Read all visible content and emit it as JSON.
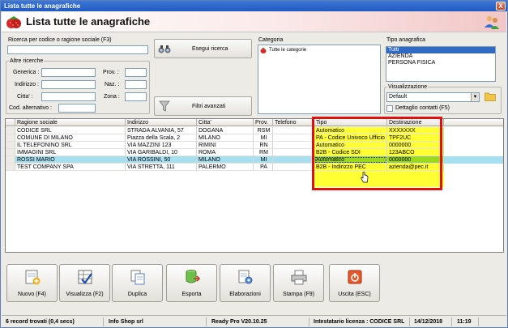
{
  "window": {
    "title": "Lista tutte le anagrafiche",
    "close_label": "X"
  },
  "header": {
    "title": "Lista tutte le anagrafiche"
  },
  "search": {
    "main_label": "Ricerca per codice o ragione sociale (F3)",
    "main_value": "",
    "execute_label": "Esegui ricerca",
    "other_label": "Altre ricerche",
    "fields": {
      "generica": "Generica :",
      "indirizzo": "Indirizzo :",
      "citta": "Citta' :",
      "cod_alt": "Cod. alternativo :",
      "prov": "Prov. :",
      "naz": "Naz. :",
      "zona": "Zona :"
    },
    "advanced_label": "Filtri avanzati"
  },
  "category": {
    "label": "Categoria",
    "item": "Tutte le categorie"
  },
  "tipo_anagrafica": {
    "label": "Tipo anagrafica",
    "items": [
      "Tutti",
      "AZIENDA",
      "PERSONA FISICA"
    ]
  },
  "visualizzazione": {
    "label": "Visualizzazione",
    "value": "Default",
    "checkbox_label": "Dettaglio contatti (F5)"
  },
  "grid": {
    "headers": [
      "Ragione sociale",
      "Indirizzo",
      "Citta'",
      "Prov.",
      "Telefono",
      "Tipo",
      "Destinazione"
    ],
    "rows": [
      [
        "CODICE SRL",
        "STRADA ALVANIA, 57",
        "DOGANA",
        "RSM",
        "",
        "Automatico",
        "XXXXXXX"
      ],
      [
        "COMUNE DI MILANO",
        "Piazza della Scala, 2",
        "MILANO",
        "MI",
        "",
        "PA - Codice Univoco Ufficio CUU",
        "TPF2UC"
      ],
      [
        "IL TELEFONINO SRL",
        "VIA MAZZINI 123",
        "RIMINI",
        "RN",
        "",
        "Automatico",
        "0000000"
      ],
      [
        "IMMAGINI SRL",
        "VIA GARIBALDI, 10",
        "ROMA",
        "RM",
        "",
        "B2B - Codice SDI",
        "123ABCO"
      ],
      [
        "ROSSI MARIO",
        "VIA ROSSINI, 50",
        "MILANO",
        "MI",
        "",
        "Automatico",
        "0000000"
      ],
      [
        "TEST COMPANY SPA",
        "VIA STRETTA, 111",
        "PALERMO",
        "PA",
        "",
        "B2B - Indirizzo PEC",
        "azienda@pec.it"
      ]
    ]
  },
  "toolbar": {
    "nuovo": "Nuovo (F4)",
    "visualizza": "Visualizza (F2)",
    "duplica": "Duplica",
    "esporta": "Esporta",
    "elaborazioni": "Elaborazioni",
    "stampa": "Stampa (F9)",
    "uscita": "Uscita (ESC)"
  },
  "status": {
    "records": "6 record trovati (0,4 secs)",
    "company": "Info Shop srl",
    "version": "Ready Pro V20.10.25",
    "license": "Intestatario licenza : CODICE SRL",
    "date": "14/12/2018",
    "time": "11:19"
  },
  "colors": {
    "title_bar": "#215ac0",
    "highlight_frame": "#e01010",
    "yellow": "#ffff33",
    "green": "#9ad91a",
    "selected_row": "#a6dff0"
  }
}
